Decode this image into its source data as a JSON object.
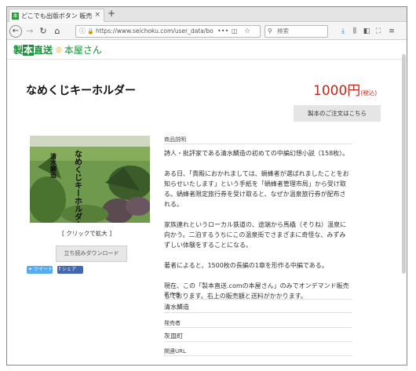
{
  "browser": {
    "tab_title": "どこでも出版ボタン 販売",
    "tab_close": "×",
    "new_tab": "+",
    "url": "https://www.seichoku.com/user_data/bo",
    "url_more": "•••",
    "search_placeholder": "検索"
  },
  "site": {
    "logo_prefix": "製",
    "logo_highlight": "本",
    "logo_suffix": "直送",
    "logo_sep": "◎",
    "logo_part2": "本屋さん"
  },
  "product": {
    "title": "なめくじキーホルダー",
    "price": "1000円",
    "tax": "(税込)",
    "order_button": "製本のご注文はこちら",
    "cover_text_1": "なめくじキーホルダー",
    "cover_text_2": "清水鱗造",
    "enlarge": "[ クリックで拡大 ]",
    "download_button": "立ち読みダウンロード",
    "tweet": "ツイート",
    "share": "シェア"
  },
  "description": {
    "label": "商品説明",
    "p1": "詩人・批評家である清水鱗造の初めての中編幻想小説（158枚）。",
    "p2": "ある日、「貴殿におかれましては、蝸蜂者が選ばれましたことをお知らせいたします」という手紙を「蝸蜂者管理市局」から受け取る。蝸蜂者限定旅行券を受け取ると、なぜか温泉旅行券が配布される。",
    "p3": "家族連れというローカル鉄道の、途端から馬橇（そりね）温泉に向かう。二泊するうちにこの温泉街でさまざまに奇怪な、みずみずしい体験をすることになる。",
    "p4": "著者によると、1500枚の長編の1章を形作る中編である。",
    "p5": "現在、この「製本直送.comの本屋さん」のみでオンデマンド販売しております。右上の販売額と送料がかかります。"
  },
  "meta": {
    "author_label": "著作者",
    "author_value": "清水鱗造",
    "publisher_label": "発売者",
    "publisher_value": "灰皿町",
    "url_label": "関連URL"
  }
}
